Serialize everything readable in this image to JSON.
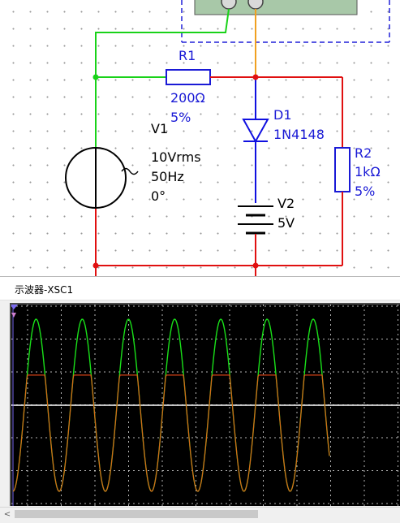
{
  "schematic": {
    "components": {
      "r1": {
        "name": "R1",
        "value": "200Ω",
        "tolerance": "5%"
      },
      "d1": {
        "name": "D1",
        "model": "1N4148"
      },
      "r2": {
        "name": "R2",
        "value": "1kΩ",
        "tolerance": "5%"
      },
      "v1": {
        "name": "V1",
        "amplitude": "10Vrms",
        "frequency": "50Hz",
        "phase": "0°"
      },
      "v2": {
        "name": "V2",
        "value": "5V"
      }
    },
    "wire_colors": {
      "green": "#19d219",
      "red": "#e01010",
      "blue": "#1010e0",
      "orange": "#f0a020",
      "instrument_box": "#2020d8"
    }
  },
  "oscilloscope": {
    "title": "示波器-XSC1",
    "colors": {
      "background": "#000000",
      "grid": "#ffffff",
      "channel_a": "#19e019",
      "channel_b": "#ff4d1a",
      "overlap": "#e6c31a"
    },
    "trace_data": {
      "cycles_visible": 7,
      "channel_a": {
        "shape": "sine",
        "clipped": false
      },
      "channel_b": {
        "shape": "sine",
        "clipped_at_top": true,
        "clip_level_fraction_of_peak": 0.35
      }
    }
  }
}
